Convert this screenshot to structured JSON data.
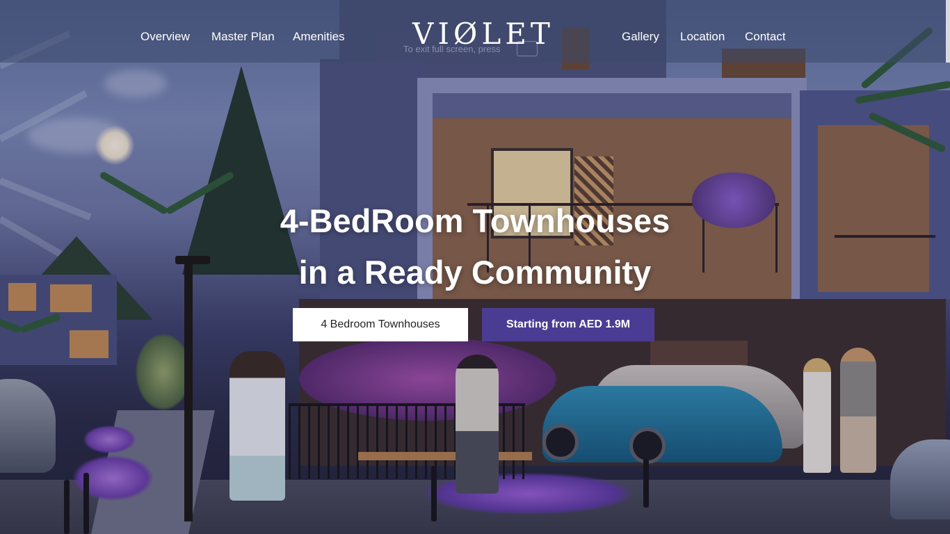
{
  "nav": {
    "left": [
      "Overview",
      "Master Plan",
      "Amenities"
    ],
    "right": [
      "Gallery",
      "Location",
      "Contact"
    ],
    "logo": "VIØLET"
  },
  "fullscreen_hint": "To exit full screen, press",
  "hero": {
    "line1": "4-BedRoom Townhouses",
    "line2": "in a Ready Community"
  },
  "buttons": {
    "primary": "4 Bedroom Townhouses",
    "secondary": "Starting from AED 1.9M"
  },
  "colors": {
    "accent": "#4b3c93",
    "nav_bg": "rgba(60,72,108,.55)"
  }
}
